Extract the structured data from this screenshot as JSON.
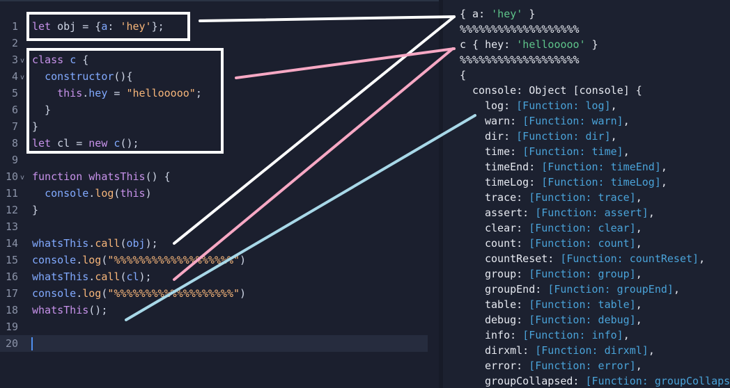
{
  "editor": {
    "lines": [
      {
        "n": "1",
        "fold": "",
        "tokens": [
          [
            "kw",
            "let"
          ],
          [
            "co",
            " obj = {"
          ],
          [
            "pr",
            "a"
          ],
          [
            "co",
            ": "
          ],
          [
            "st",
            "'hey'"
          ],
          [
            "co",
            "};"
          ]
        ]
      },
      {
        "n": "2",
        "fold": "",
        "tokens": []
      },
      {
        "n": "3",
        "fold": "v",
        "tokens": [
          [
            "kw",
            "class"
          ],
          [
            "co",
            " "
          ],
          [
            "pr",
            "c"
          ],
          [
            "co",
            " {"
          ]
        ]
      },
      {
        "n": "4",
        "fold": "v",
        "tokens": [
          [
            "co",
            "  "
          ],
          [
            "pr",
            "constructor"
          ],
          [
            "co",
            "(){"
          ]
        ]
      },
      {
        "n": "5",
        "fold": "",
        "tokens": [
          [
            "co",
            "    "
          ],
          [
            "kw",
            "this"
          ],
          [
            "co",
            "."
          ],
          [
            "pr",
            "hey"
          ],
          [
            "co",
            " = "
          ],
          [
            "st",
            "\"hellooooo\""
          ],
          [
            "co",
            ";"
          ]
        ]
      },
      {
        "n": "6",
        "fold": "",
        "tokens": [
          [
            "co",
            "  }"
          ]
        ]
      },
      {
        "n": "7",
        "fold": "",
        "tokens": [
          [
            "co",
            "}"
          ]
        ]
      },
      {
        "n": "8",
        "fold": "",
        "tokens": [
          [
            "kw",
            "let"
          ],
          [
            "co",
            " cl = "
          ],
          [
            "kw",
            "new"
          ],
          [
            "co",
            " "
          ],
          [
            "pr",
            "c"
          ],
          [
            "co",
            "();"
          ]
        ]
      },
      {
        "n": "9",
        "fold": "",
        "tokens": []
      },
      {
        "n": "10",
        "fold": "v",
        "tokens": [
          [
            "kw",
            "function"
          ],
          [
            "co",
            " "
          ],
          [
            "fn",
            "whatsThis"
          ],
          [
            "co",
            "() {"
          ]
        ]
      },
      {
        "n": "11",
        "fold": "",
        "tokens": [
          [
            "co",
            "  "
          ],
          [
            "pr",
            "console"
          ],
          [
            "co",
            "."
          ],
          [
            "st",
            "log"
          ],
          [
            "co",
            "("
          ],
          [
            "kw",
            "this"
          ],
          [
            "co",
            ")"
          ]
        ]
      },
      {
        "n": "12",
        "fold": "",
        "tokens": [
          [
            "co",
            "}"
          ]
        ]
      },
      {
        "n": "13",
        "fold": "",
        "tokens": []
      },
      {
        "n": "14",
        "fold": "",
        "tokens": [
          [
            "pr",
            "whatsThis"
          ],
          [
            "co",
            "."
          ],
          [
            "st",
            "call"
          ],
          [
            "co",
            "("
          ],
          [
            "pr",
            "obj"
          ],
          [
            "co",
            ");"
          ]
        ]
      },
      {
        "n": "15",
        "fold": "",
        "tokens": [
          [
            "pr",
            "console"
          ],
          [
            "co",
            "."
          ],
          [
            "st",
            "log"
          ],
          [
            "co",
            "("
          ],
          [
            "st",
            "\"%%%%%%%%%%%%%%%%%%%\""
          ],
          [
            "co",
            ")"
          ]
        ]
      },
      {
        "n": "16",
        "fold": "",
        "tokens": [
          [
            "pr",
            "whatsThis"
          ],
          [
            "co",
            "."
          ],
          [
            "st",
            "call"
          ],
          [
            "co",
            "("
          ],
          [
            "pr",
            "cl"
          ],
          [
            "co",
            ");"
          ]
        ]
      },
      {
        "n": "17",
        "fold": "",
        "tokens": [
          [
            "pr",
            "console"
          ],
          [
            "co",
            "."
          ],
          [
            "st",
            "log"
          ],
          [
            "co",
            "("
          ],
          [
            "st",
            "\"%%%%%%%%%%%%%%%%%%%\""
          ],
          [
            "co",
            ")"
          ]
        ]
      },
      {
        "n": "18",
        "fold": "",
        "tokens": [
          [
            "fn",
            "whatsThis"
          ],
          [
            "co",
            "();"
          ]
        ]
      },
      {
        "n": "19",
        "fold": "",
        "tokens": []
      },
      {
        "n": "20",
        "fold": "",
        "tokens": [],
        "active": true
      }
    ]
  },
  "console": {
    "lines": [
      {
        "indent": 0,
        "tokens": [
          [
            "",
            "{ a: "
          ],
          [
            "g",
            "'hey'"
          ],
          [
            "",
            " }"
          ]
        ]
      },
      {
        "indent": 0,
        "tokens": [
          [
            "",
            "%%%%%%%%%%%%%%%%%%%"
          ]
        ]
      },
      {
        "indent": 0,
        "tokens": [
          [
            "",
            "c { hey: "
          ],
          [
            "g",
            "'hellooooo'"
          ],
          [
            "",
            " }"
          ]
        ]
      },
      {
        "indent": 0,
        "tokens": [
          [
            "",
            "%%%%%%%%%%%%%%%%%%%"
          ]
        ]
      },
      {
        "indent": 0,
        "tokens": [
          [
            "",
            "{"
          ]
        ]
      },
      {
        "indent": 1,
        "tokens": [
          [
            "",
            "console: Object [console] {"
          ]
        ]
      },
      {
        "indent": 2,
        "tokens": [
          [
            "",
            "log: "
          ],
          [
            "b",
            "[Function: log]"
          ],
          [
            "",
            ","
          ]
        ]
      },
      {
        "indent": 2,
        "tokens": [
          [
            "",
            "warn: "
          ],
          [
            "b",
            "[Function: warn]"
          ],
          [
            "",
            ","
          ]
        ]
      },
      {
        "indent": 2,
        "tokens": [
          [
            "",
            "dir: "
          ],
          [
            "b",
            "[Function: dir]"
          ],
          [
            "",
            ","
          ]
        ]
      },
      {
        "indent": 2,
        "tokens": [
          [
            "",
            "time: "
          ],
          [
            "b",
            "[Function: time]"
          ],
          [
            "",
            ","
          ]
        ]
      },
      {
        "indent": 2,
        "tokens": [
          [
            "",
            "timeEnd: "
          ],
          [
            "b",
            "[Function: timeEnd]"
          ],
          [
            "",
            ","
          ]
        ]
      },
      {
        "indent": 2,
        "tokens": [
          [
            "",
            "timeLog: "
          ],
          [
            "b",
            "[Function: timeLog]"
          ],
          [
            "",
            ","
          ]
        ]
      },
      {
        "indent": 2,
        "tokens": [
          [
            "",
            "trace: "
          ],
          [
            "b",
            "[Function: trace]"
          ],
          [
            "",
            ","
          ]
        ]
      },
      {
        "indent": 2,
        "tokens": [
          [
            "",
            "assert: "
          ],
          [
            "b",
            "[Function: assert]"
          ],
          [
            "",
            ","
          ]
        ]
      },
      {
        "indent": 2,
        "tokens": [
          [
            "",
            "clear: "
          ],
          [
            "b",
            "[Function: clear]"
          ],
          [
            "",
            ","
          ]
        ]
      },
      {
        "indent": 2,
        "tokens": [
          [
            "",
            "count: "
          ],
          [
            "b",
            "[Function: count]"
          ],
          [
            "",
            ","
          ]
        ]
      },
      {
        "indent": 2,
        "tokens": [
          [
            "",
            "countReset: "
          ],
          [
            "b",
            "[Function: countReset]"
          ],
          [
            "",
            ","
          ]
        ]
      },
      {
        "indent": 2,
        "tokens": [
          [
            "",
            "group: "
          ],
          [
            "b",
            "[Function: group]"
          ],
          [
            "",
            ","
          ]
        ]
      },
      {
        "indent": 2,
        "tokens": [
          [
            "",
            "groupEnd: "
          ],
          [
            "b",
            "[Function: groupEnd]"
          ],
          [
            "",
            ","
          ]
        ]
      },
      {
        "indent": 2,
        "tokens": [
          [
            "",
            "table: "
          ],
          [
            "b",
            "[Function: table]"
          ],
          [
            "",
            ","
          ]
        ]
      },
      {
        "indent": 2,
        "tokens": [
          [
            "",
            "debug: "
          ],
          [
            "b",
            "[Function: debug]"
          ],
          [
            "",
            ","
          ]
        ]
      },
      {
        "indent": 2,
        "tokens": [
          [
            "",
            "info: "
          ],
          [
            "b",
            "[Function: info]"
          ],
          [
            "",
            ","
          ]
        ]
      },
      {
        "indent": 2,
        "tokens": [
          [
            "",
            "dirxml: "
          ],
          [
            "b",
            "[Function: dirxml]"
          ],
          [
            "",
            ","
          ]
        ]
      },
      {
        "indent": 2,
        "tokens": [
          [
            "",
            "error: "
          ],
          [
            "b",
            "[Function: error]"
          ],
          [
            "",
            ","
          ]
        ]
      },
      {
        "indent": 2,
        "tokens": [
          [
            "",
            "groupCollapsed: "
          ],
          [
            "b",
            "[Function: groupCollapsed]"
          ],
          [
            "",
            ","
          ]
        ]
      }
    ]
  },
  "annotations": {
    "colors": {
      "white": "#ffffff",
      "pink": "#f7a8c4",
      "blue": "#a8d8e8"
    }
  }
}
